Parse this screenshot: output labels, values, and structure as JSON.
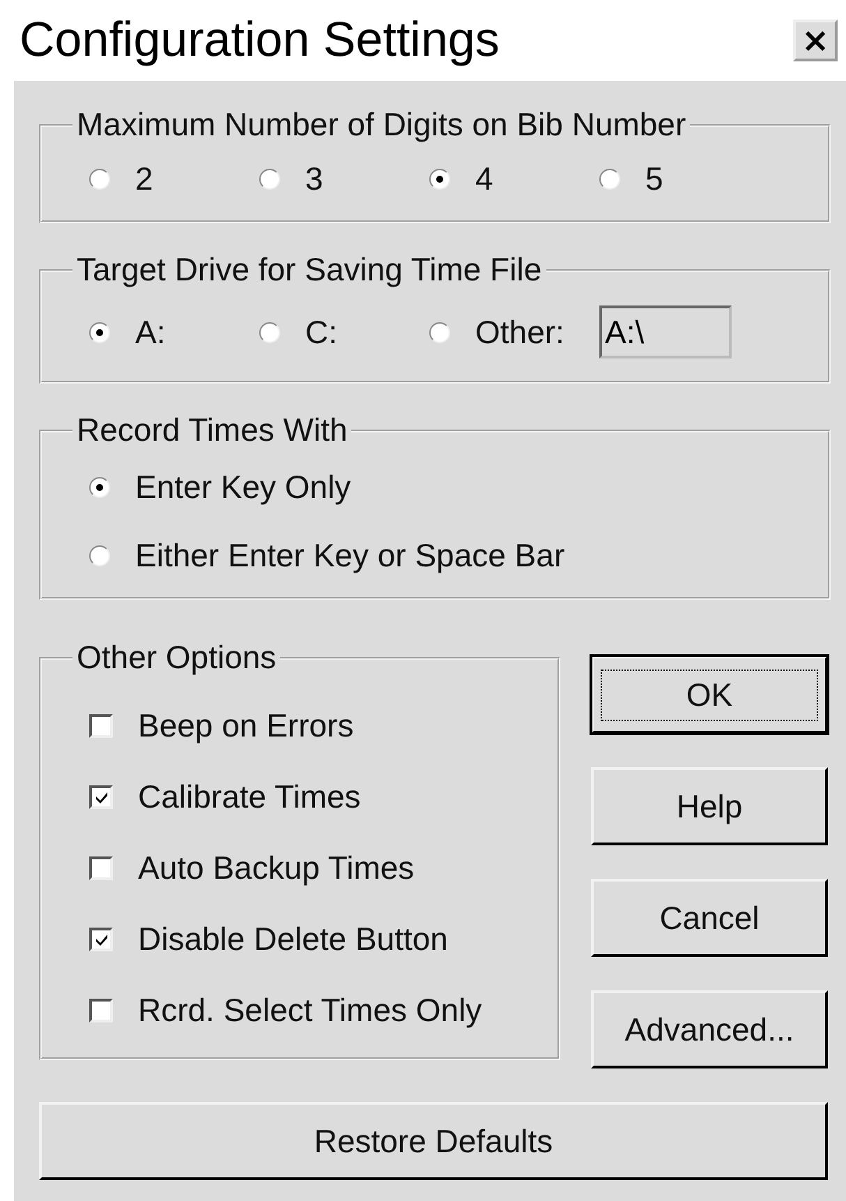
{
  "window": {
    "title": "Configuration Settings",
    "close": "×"
  },
  "digits": {
    "label": "Maximum Number of Digits on Bib Number",
    "options": [
      {
        "label": "2",
        "selected": false
      },
      {
        "label": "3",
        "selected": false
      },
      {
        "label": "4",
        "selected": true
      },
      {
        "label": "5",
        "selected": false
      }
    ]
  },
  "target_drive": {
    "label": "Target Drive for Saving Time File",
    "options": [
      {
        "label": "A:",
        "selected": true
      },
      {
        "label": "C:",
        "selected": false
      },
      {
        "label": "Other:",
        "selected": false
      }
    ],
    "other_path": "A:\\"
  },
  "record_times": {
    "label": "Record Times With",
    "options": [
      {
        "label": "Enter Key Only",
        "selected": true
      },
      {
        "label": "Either Enter Key or Space Bar",
        "selected": false
      }
    ]
  },
  "other_options": {
    "label": "Other Options",
    "items": [
      {
        "label": "Beep on Errors",
        "checked": false
      },
      {
        "label": "Calibrate Times",
        "checked": true
      },
      {
        "label": "Auto Backup Times",
        "checked": false
      },
      {
        "label": "Disable Delete Button",
        "checked": true
      },
      {
        "label": "Rcrd. Select Times Only",
        "checked": false
      }
    ]
  },
  "buttons": [
    {
      "label": "OK",
      "default": true
    },
    {
      "label": "Help",
      "default": false
    },
    {
      "label": "Cancel",
      "default": false
    },
    {
      "label": "Advanced...",
      "default": false
    }
  ],
  "restore_button": {
    "label": "Restore Defaults"
  }
}
